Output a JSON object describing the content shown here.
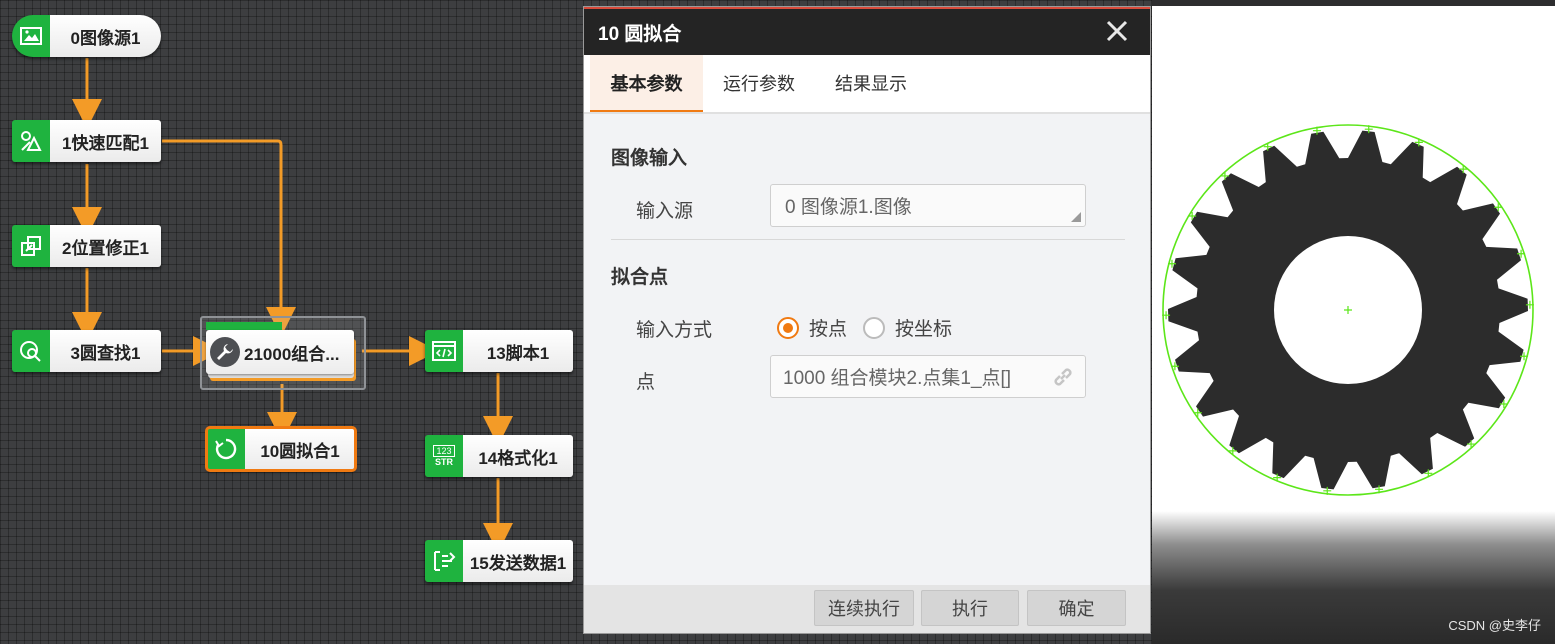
{
  "flow": {
    "nodes": {
      "image_source": "0图像源1",
      "fast_match": "1快速匹配1",
      "position_fix": "2位置修正1",
      "circle_find": "3圆查找1",
      "combo_module": "21000组合...",
      "circle_fit": "10圆拟合1",
      "script": "13脚本1",
      "format": "14格式化1",
      "send_data": "15发送数据1"
    },
    "format_icon_text_top": "123",
    "format_icon_text_bottom": "STR"
  },
  "dialog": {
    "title": "10 圆拟合",
    "tabs": [
      "基本参数",
      "运行参数",
      "结果显示"
    ],
    "active_tab": 0,
    "sections": {
      "image_input": {
        "title": "图像输入",
        "source_label": "输入源",
        "source_value": "0 图像源1.图像"
      },
      "fit_points": {
        "title": "拟合点",
        "mode_label": "输入方式",
        "mode_options": [
          "按点",
          "按坐标"
        ],
        "mode_selected": "按点",
        "points_label": "点",
        "points_value": "1000 组合模块2.点集1_点[]"
      }
    },
    "buttons": {
      "continuous": "连续执行",
      "run": "执行",
      "ok": "确定"
    }
  },
  "image": {
    "watermark": "CSDN @史李仔"
  },
  "colors": {
    "node_green": "#1fb33f",
    "wire_orange": "#f39b27",
    "accent_orange": "#f07a12",
    "fit_circle": "#5ce619"
  }
}
